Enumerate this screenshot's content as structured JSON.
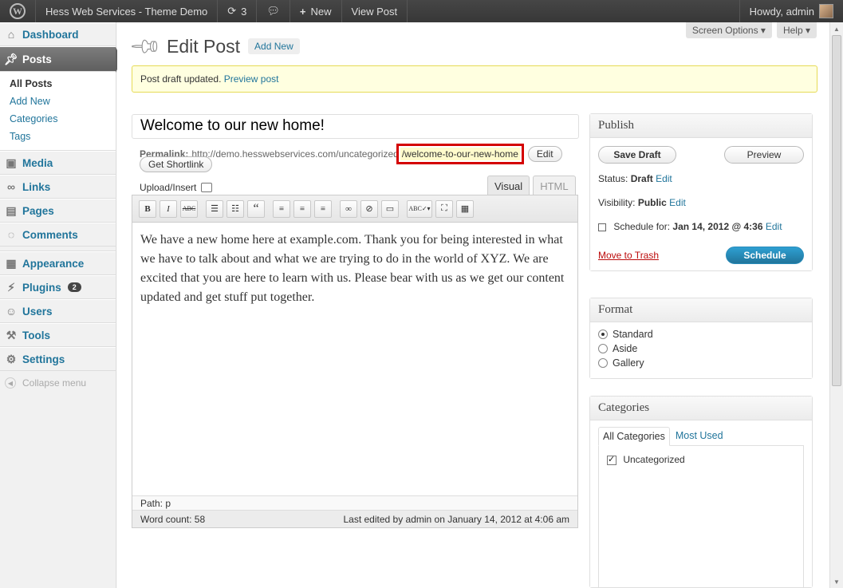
{
  "adminbar": {
    "site_name": "Hess Web Services - Theme Demo",
    "updates_count": "3",
    "new_label": "New",
    "view_post": "View Post",
    "howdy": "Howdy, admin"
  },
  "sidebar": {
    "dashboard": "Dashboard",
    "posts": "Posts",
    "posts_sub": [
      "All Posts",
      "Add New",
      "Categories",
      "Tags"
    ],
    "media": "Media",
    "links": "Links",
    "pages": "Pages",
    "comments": "Comments",
    "appearance": "Appearance",
    "plugins": "Plugins",
    "plugins_badge": "2",
    "users": "Users",
    "tools": "Tools",
    "settings": "Settings",
    "collapse": "Collapse menu"
  },
  "header": {
    "screen_options": "Screen Options ▾",
    "help": "Help ▾",
    "title": "Edit Post",
    "add_new": "Add New"
  },
  "notice": {
    "text": "Post draft updated.",
    "link": "Preview post"
  },
  "post": {
    "title": "Welcome to our new home!",
    "permalink_label": "Permalink:",
    "permalink_base": "http://demo.hesswebservices.com/uncategorized",
    "permalink_slug": "/welcome-to-our-new-home",
    "edit_btn": "Edit",
    "shortlink_btn": "Get Shortlink",
    "upload_insert": "Upload/Insert",
    "tab_visual": "Visual",
    "tab_html": "HTML",
    "content": "We have a new home here at example.com. Thank you for being interested in what we have to talk about and what we are trying to do in the world of XYZ. We are excited that you are here to learn with us. Please bear with us as we get our content updated and get stuff put together.",
    "path_label": "Path:",
    "path_value": "p",
    "word_count": "Word count: 58",
    "last_edited": "Last edited by admin on January 14, 2012 at 4:06 am"
  },
  "publish": {
    "title": "Publish",
    "save_draft": "Save Draft",
    "preview": "Preview",
    "status_label": "Status:",
    "status_value": "Draft",
    "visibility_label": "Visibility:",
    "visibility_value": "Public",
    "schedule_label": "Schedule for:",
    "schedule_value": "Jan 14, 2012 @ 4:36",
    "edit_link": "Edit",
    "trash": "Move to Trash",
    "schedule_btn": "Schedule"
  },
  "format": {
    "title": "Format",
    "options": [
      "Standard",
      "Aside",
      "Gallery"
    ],
    "selected": "Standard"
  },
  "categories": {
    "title": "Categories",
    "tab_all": "All Categories",
    "tab_most": "Most Used",
    "items": [
      "Uncategorized"
    ]
  }
}
